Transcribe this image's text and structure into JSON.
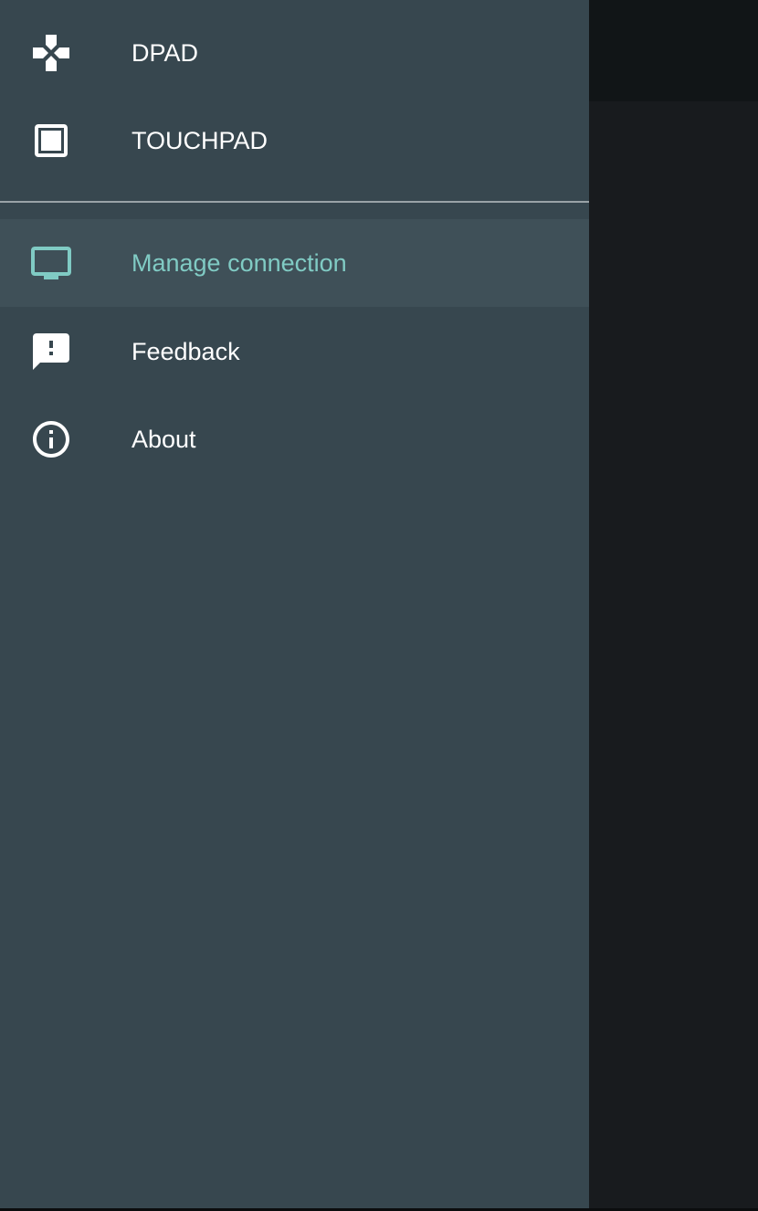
{
  "drawer": {
    "mode_items": [
      {
        "label": "DPAD",
        "icon": "gamepad-icon"
      },
      {
        "label": "TOUCHPAD",
        "icon": "touchpad-icon"
      }
    ],
    "nav_items": [
      {
        "label": "Manage connection",
        "icon": "tv-icon",
        "selected": true
      },
      {
        "label": "Feedback",
        "icon": "feedback-icon",
        "selected": false
      },
      {
        "label": "About",
        "icon": "info-icon",
        "selected": false
      }
    ]
  },
  "colors": {
    "drawer_background": "#37474f",
    "selected_background": "#3f5058",
    "accent": "#80cbc4",
    "text": "#ffffff",
    "scrim": "#181b1e"
  }
}
